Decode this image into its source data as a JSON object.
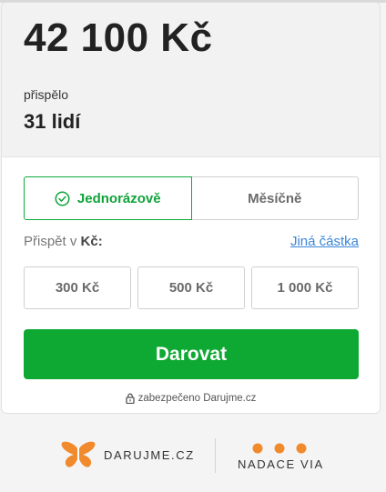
{
  "stats": {
    "amount": "42 100 Kč",
    "contributed_label": "přispělo",
    "people": "31 lidí"
  },
  "frequency": {
    "one_time": "Jednorázově",
    "monthly": "Měsíčně",
    "selected": "one_time"
  },
  "contribute": {
    "prefix": "Přispět v",
    "currency": "Kč:",
    "other_amount": "Jiná částka"
  },
  "amounts": [
    "300 Kč",
    "500 Kč",
    "1 000 Kč"
  ],
  "donate_label": "Darovat",
  "secure_text": "zabezpečeno Darujme.cz",
  "footer": {
    "brand_left": "DARUJME.CZ",
    "brand_right": "NADACE VIA"
  },
  "colors": {
    "primary_green": "#0ea933",
    "link_blue": "#3a86d8",
    "brand_orange": "#f08a2c"
  },
  "icons": {
    "check": "check-circle-icon",
    "lock": "lock-icon",
    "logo_left": "butterfly-icon",
    "logo_right": "three-dots-icon"
  }
}
